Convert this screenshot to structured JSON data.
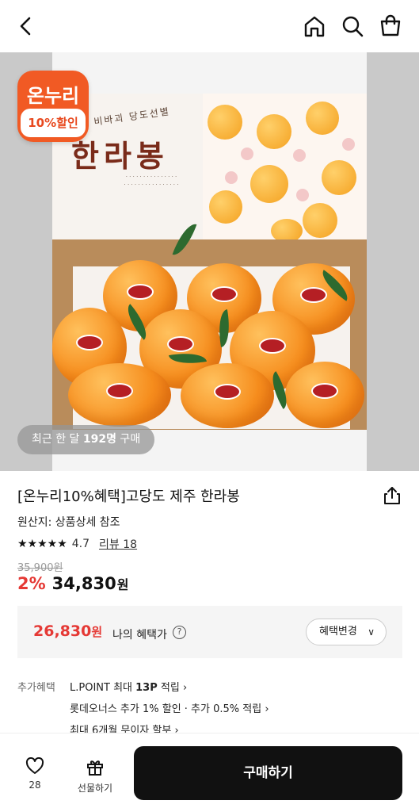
{
  "header": {
    "icons": [
      "back-icon",
      "home-icon",
      "search-icon",
      "cart-icon"
    ]
  },
  "hero": {
    "badge_logo": "온누리",
    "badge_discount": "10%할인",
    "box_title": "한라봉",
    "box_subtitle": "비바괴 당도선별",
    "recent_prefix": "최근 한 달 ",
    "recent_count": "192명",
    "recent_suffix": " 구매"
  },
  "product": {
    "title": "[온누리10%혜택]고당도 제주 한라봉",
    "origin": "원산지: 상품상세 참조",
    "stars": "★★★★★",
    "rating": "4.7",
    "review_link": "리뷰 18",
    "original_price": "35,900원",
    "discount_rate": "2%",
    "sale_price": "34,830",
    "won": "원"
  },
  "benefit": {
    "price": "26,830",
    "won": "원",
    "label": "나의 혜택가",
    "button": "혜택변경"
  },
  "extra_benefits": {
    "label": "추가혜택",
    "line1_prefix": "L.POINT 최대 ",
    "line1_bold": "13P",
    "line1_suffix": " 적립 ›",
    "line2": "롯데오너스 추가 1% 할인 · 추가 0.5% 적립 ›",
    "line3": "최대 6개월 무이자 할부 ›"
  },
  "bottom_bar": {
    "like_count": "28",
    "gift_label": "선물하기",
    "buy_label": "구매하기"
  },
  "colors": {
    "accent_red": "#e53935",
    "badge_orange": "#f15a24",
    "buy_button": "#111111"
  }
}
